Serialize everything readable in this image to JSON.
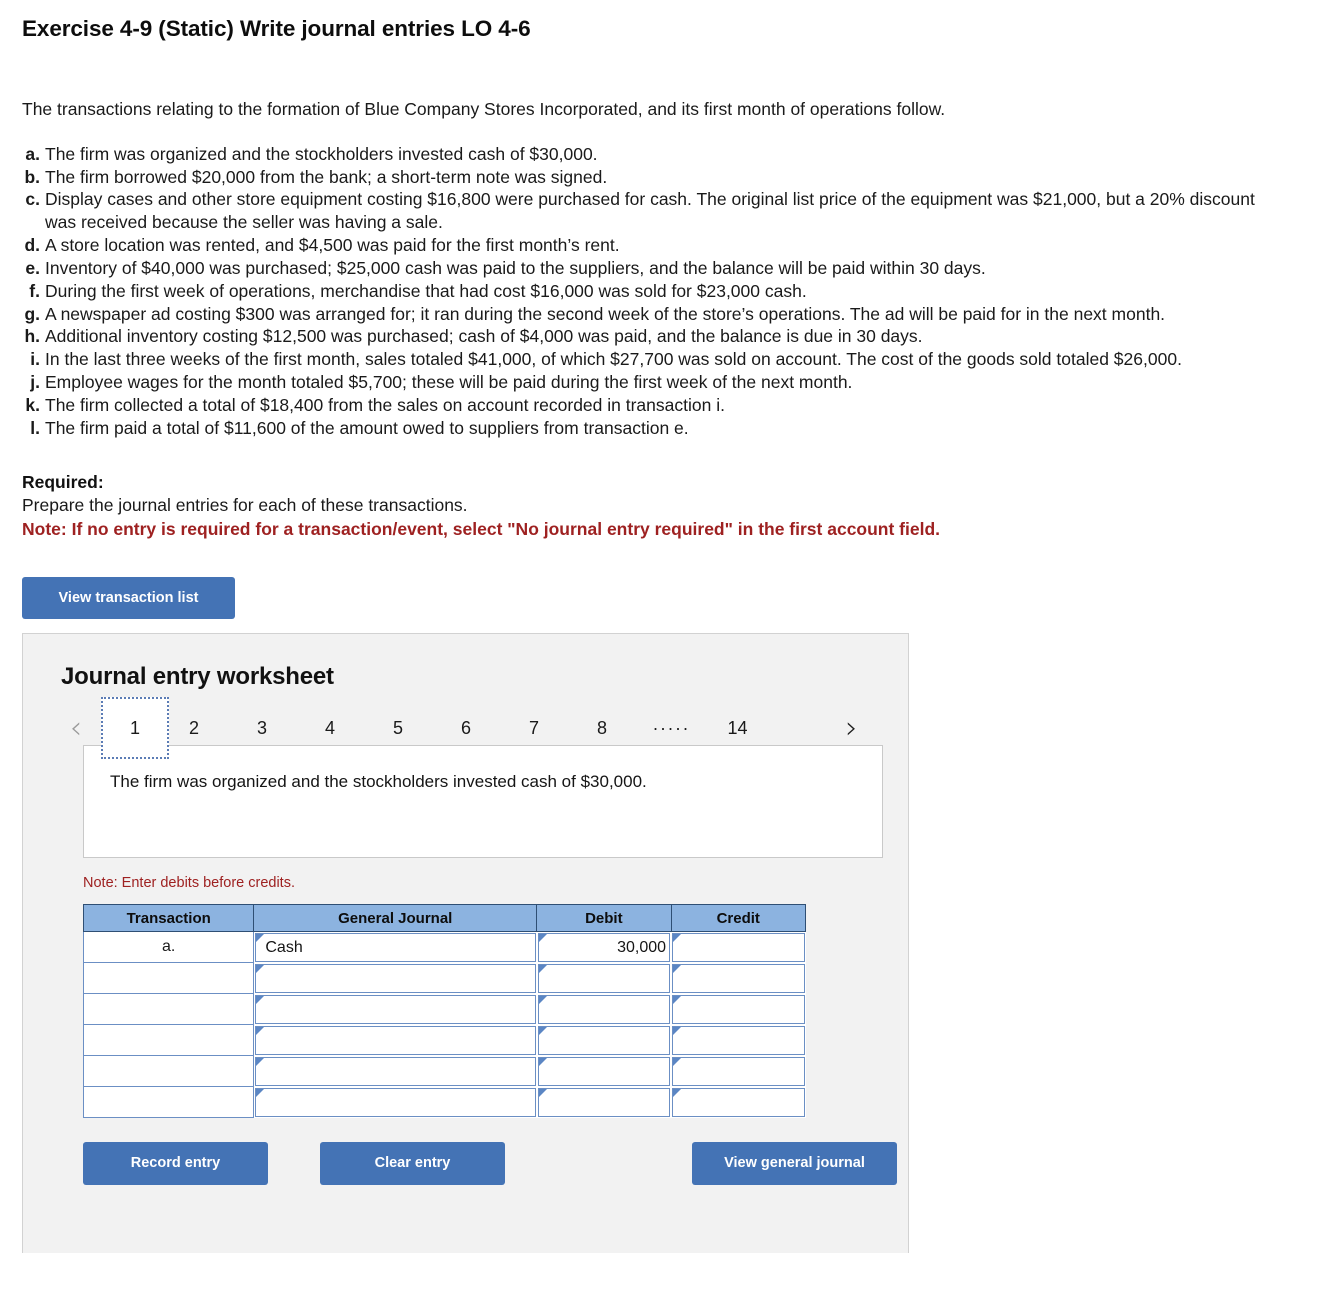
{
  "exercise": {
    "title": "Exercise 4-9 (Static) Write journal entries LO 4-6",
    "intro": "The transactions relating to the formation of Blue Company Stores Incorporated, and its first month of operations follow."
  },
  "transactions": [
    {
      "letter": "a.",
      "text": "The firm was organized and the stockholders invested cash of $30,000."
    },
    {
      "letter": "b.",
      "text": "The firm borrowed $20,000 from the bank; a short-term note was signed."
    },
    {
      "letter": "c.",
      "text": "Display cases and other store equipment costing $16,800 were purchased for cash. The original list price of the equipment was $21,000, but a 20% discount was received because the seller was having a sale."
    },
    {
      "letter": "d.",
      "text": "A store location was rented, and $4,500 was paid for the first month’s rent."
    },
    {
      "letter": "e.",
      "text": "Inventory of $40,000 was purchased; $25,000 cash was paid to the suppliers, and the balance will be paid within 30 days."
    },
    {
      "letter": "f.",
      "text": "During the first week of operations, merchandise that had cost $16,000 was sold for $23,000 cash."
    },
    {
      "letter": "g.",
      "text": "A newspaper ad costing $300 was arranged for; it ran during the second week of the store’s operations. The ad will be paid for in the next month."
    },
    {
      "letter": "h.",
      "text": "Additional inventory costing $12,500 was purchased; cash of $4,000 was paid, and the balance is due in 30 days."
    },
    {
      "letter": "i.",
      "text": "In the last three weeks of the first month, sales totaled $41,000, of which $27,700 was sold on account. The cost of the goods sold totaled $26,000."
    },
    {
      "letter": "j.",
      "text": "Employee wages for the month totaled $5,700; these will be paid during the first week of the next month."
    },
    {
      "letter": "k.",
      "text": "The firm collected a total of $18,400 from the sales on account recorded in transaction i."
    },
    {
      "letter": "l.",
      "text": "The firm paid a total of $11,600 of the amount owed to suppliers from transaction e."
    }
  ],
  "required": {
    "label": "Required:",
    "text": "Prepare the journal entries for each of these transactions.",
    "note": "Note: If no entry is required for a transaction/event, select \"No journal entry required\" in the first account field."
  },
  "buttons": {
    "view_transaction_list": "View transaction list",
    "record_entry": "Record entry",
    "clear_entry": "Clear entry",
    "view_general_journal": "View general journal"
  },
  "worksheet": {
    "title": "Journal entry worksheet",
    "pager": {
      "prev_arrow": "‹",
      "next_arrow": "›",
      "pages": [
        "1",
        "2",
        "3",
        "4",
        "5",
        "6",
        "7",
        "8"
      ],
      "ellipsis": ".....",
      "last_page": "14",
      "active_page": "1"
    },
    "description": "The firm was organized and the stockholders invested cash of $30,000.",
    "enter_note": "Note: Enter debits before credits.",
    "table": {
      "headers": [
        "Transaction",
        "General Journal",
        "Debit",
        "Credit"
      ],
      "rows": [
        {
          "transaction": "a.",
          "general_journal": "Cash",
          "debit": "30,000",
          "credit": ""
        },
        {
          "transaction": "",
          "general_journal": "",
          "debit": "",
          "credit": ""
        },
        {
          "transaction": "",
          "general_journal": "",
          "debit": "",
          "credit": ""
        },
        {
          "transaction": "",
          "general_journal": "",
          "debit": "",
          "credit": ""
        },
        {
          "transaction": "",
          "general_journal": "",
          "debit": "",
          "credit": ""
        },
        {
          "transaction": "",
          "general_journal": "",
          "debit": "",
          "credit": ""
        }
      ]
    }
  },
  "colors": {
    "button_blue": "#4473b5",
    "table_header_blue": "#8cb3e0",
    "note_red": "#9e2121",
    "panel_gray": "#f2f2f2"
  }
}
